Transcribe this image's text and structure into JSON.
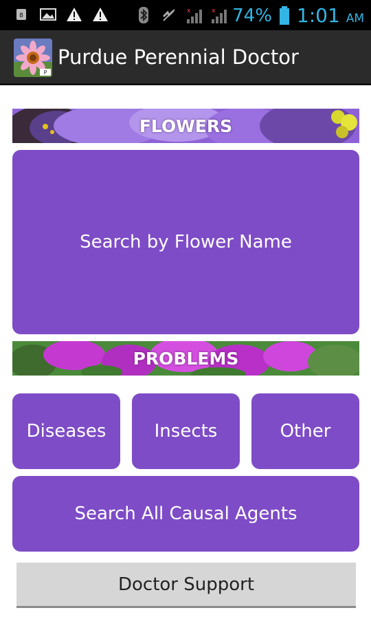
{
  "status_bar": {
    "battery": "74%",
    "time": "1:01",
    "ampm": "AM",
    "icons": [
      "notification-icon",
      "image-icon",
      "warning-icon",
      "warning-icon",
      "bluetooth-icon",
      "mute-icon",
      "signal-icon",
      "signal-icon",
      "battery-icon"
    ]
  },
  "app_bar": {
    "title": "Purdue Perennial Doctor",
    "icon": "app-flower-icon"
  },
  "sections": {
    "flowers_label": "FLOWERS",
    "problems_label": "PROBLEMS"
  },
  "buttons": {
    "search_flower": "Search by Flower Name",
    "diseases": "Diseases",
    "insects": "Insects",
    "other": "Other",
    "search_causal": "Search All Causal Agents",
    "doctor_support": "Doctor Support"
  },
  "colors": {
    "accent": "#7e4cc6",
    "status_text": "#33b5e5",
    "action_bar": "#2b2b2b"
  }
}
